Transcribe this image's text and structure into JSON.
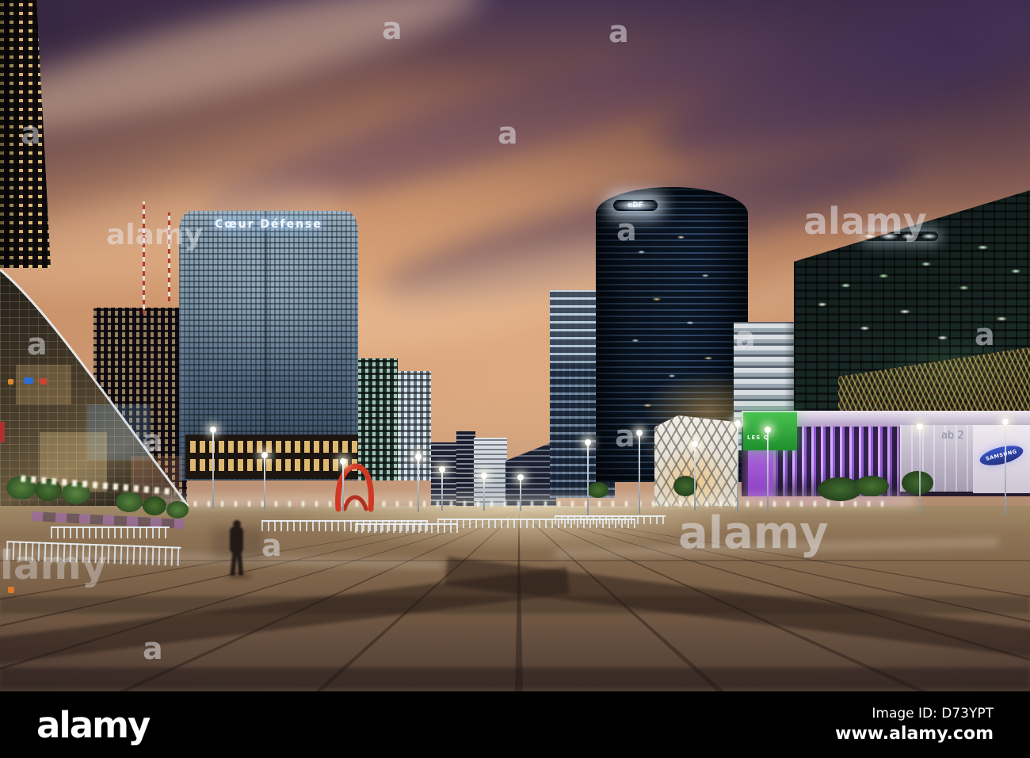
{
  "photo": {
    "signs": {
      "coeur_defense": "Cœur Défense",
      "edf": "eDF",
      "samsung": "SAMSUNG",
      "les_quatre": "LES Q",
      "mall_glass": "ab 2"
    },
    "watermark": {
      "word": "alamy",
      "letter": "a"
    }
  },
  "footer": {
    "logo": "alamy",
    "image_id": "Image ID: D73YPT",
    "url": "www.alamy.com"
  },
  "colors": {
    "sky_orange": "#c08863",
    "sky_purple": "#463350",
    "plaza_brown": "#7d6349",
    "edf_blue": "#152538",
    "mall_purple": "#8e5cd2",
    "sculpture_red": "#d03824",
    "samsung_blue": "#2b3fb5",
    "footer_bg": "#000000"
  }
}
